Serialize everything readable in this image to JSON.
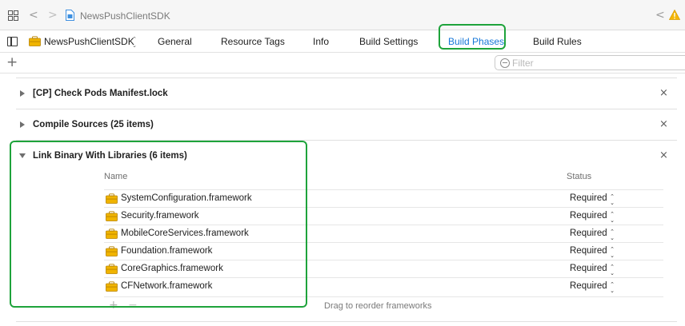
{
  "jumpbar": {
    "title": "NewsPushClientSDK",
    "back_glyph": "<",
    "forward_glyph": ">",
    "prev_issue_glyph": "<",
    "warning_color": "#f5b700"
  },
  "tabbar": {
    "target_name": "NewsPushClientSDK",
    "target_chevron": "⌃⌄",
    "tabs": [
      {
        "label": "General",
        "active": false
      },
      {
        "label": "Resource Tags",
        "active": false
      },
      {
        "label": "Info",
        "active": false
      },
      {
        "label": "Build Settings",
        "active": false
      },
      {
        "label": "Build Phases",
        "active": true
      },
      {
        "label": "Build Rules",
        "active": false
      }
    ],
    "active_color": "#1677d8"
  },
  "filterbar": {
    "add_glyph": "+",
    "filter_placeholder": "Filter"
  },
  "phases": [
    {
      "title": "[CP] Check Pods Manifest.lock",
      "expanded": false
    },
    {
      "title": "Compile Sources (25 items)",
      "expanded": false
    },
    {
      "title": "Link Binary With Libraries (6 items)",
      "expanded": true
    }
  ],
  "close_glyph": "×",
  "link_libraries": {
    "columns": {
      "name": "Name",
      "status": "Status"
    },
    "rows": [
      {
        "name": "SystemConfiguration.framework",
        "status": "Required"
      },
      {
        "name": "Security.framework",
        "status": "Required"
      },
      {
        "name": "MobileCoreServices.framework",
        "status": "Required"
      },
      {
        "name": "Foundation.framework",
        "status": "Required"
      },
      {
        "name": "CoreGraphics.framework",
        "status": "Required"
      },
      {
        "name": "CFNetwork.framework",
        "status": "Required"
      }
    ],
    "stepper_glyph": "⌃⌄",
    "add_glyph": "+",
    "remove_glyph": "−",
    "drag_hint": "Drag to reorder frameworks"
  },
  "highlight_color": "#1ea33b",
  "framework_icon_color": "#e8a400"
}
